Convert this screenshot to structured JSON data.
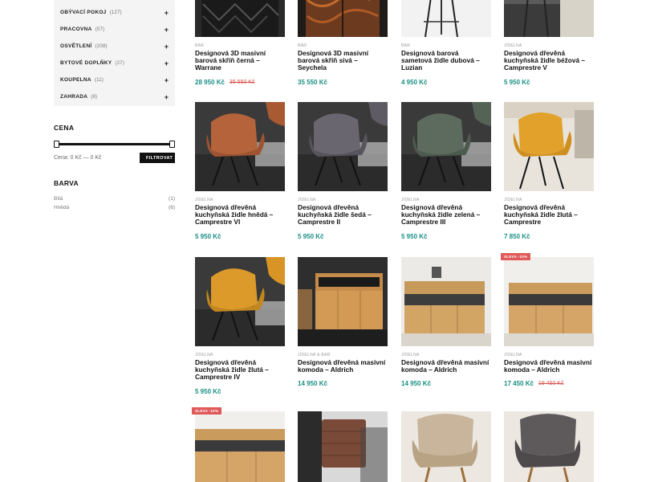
{
  "categories": [
    {
      "name": "OBÝVACÍ POKOJ",
      "count": "(127)",
      "expand": "+"
    },
    {
      "name": "PRACOVNA",
      "count": "(57)",
      "expand": "+"
    },
    {
      "name": "OSVĚTLENÍ",
      "count": "(208)",
      "expand": "+"
    },
    {
      "name": "BYTOVÉ DOPLŇKY",
      "count": "(27)",
      "expand": "+"
    },
    {
      "name": "KOUPELNA",
      "count": "(11)",
      "expand": "+"
    },
    {
      "name": "ZAHRADA",
      "count": "(8)",
      "expand": "+"
    }
  ],
  "price_filter": {
    "heading": "CENA",
    "label": "Cena: 0 Kč — 0 Kč",
    "button": "FILTROVAT"
  },
  "color_filter": {
    "heading": "BARVA",
    "items": [
      {
        "name": "Bílá",
        "count": "(1)"
      },
      {
        "name": "Hnědá",
        "count": "(6)"
      }
    ]
  },
  "products": [
    {
      "category": "BAR",
      "title": "Designová 3D masivní barová skříň černá – Warrane",
      "price": "28 950 Kč",
      "old_price": "35 550 Kč",
      "badge": "",
      "image": "cabinet-black"
    },
    {
      "category": "BAR",
      "title": "Designová 3D masivní barová skříň sivá – Seychela",
      "price": "35 550 Kč",
      "old_price": "",
      "badge": "",
      "image": "cabinet-wood"
    },
    {
      "category": "BAR",
      "title": "Designová barová sametová židle dubová – Luzian",
      "price": "4 950 Kč",
      "old_price": "",
      "badge": "",
      "image": "barstool"
    },
    {
      "category": "JÍDELNA",
      "title": "Designová dřevěná kuchyňská židle béžová – Camprestre V",
      "price": "5 950 Kč",
      "old_price": "",
      "badge": "",
      "image": "chair-beige-top"
    },
    {
      "category": "JÍDELNA",
      "title": "Designová dřevěná kuchyňská židle hnědá – Camprestre VI",
      "price": "5 950 Kč",
      "old_price": "",
      "badge": "",
      "image": "chair-brown"
    },
    {
      "category": "JÍDELNA",
      "title": "Designová dřevěná kuchyňská židle šedá – Camprestre II",
      "price": "5 950 Kč",
      "old_price": "",
      "badge": "",
      "image": "chair-grey"
    },
    {
      "category": "JÍDELNA",
      "title": "Designová dřevěná kuchyňská židle zelená – Camprestre III",
      "price": "5 950 Kč",
      "old_price": "",
      "badge": "",
      "image": "chair-green"
    },
    {
      "category": "JÍDELNA",
      "title": "Designová dřevěná kuchyňská židle žlutá – Camprestre",
      "price": "7 850 Kč",
      "old_price": "",
      "badge": "",
      "image": "chair-yellow-light"
    },
    {
      "category": "JÍDELNA",
      "title": "Designová dřevěná kuchyňská židle žlutá – Camprestre IV",
      "price": "5 950 Kč",
      "old_price": "",
      "badge": "",
      "image": "chair-yellow-dark"
    },
    {
      "category": "JÍDELNA & BAR",
      "title": "Designová dřevěná masivní komoda – Aldrich",
      "price": "14 950 Kč",
      "old_price": "",
      "badge": "",
      "image": "sideboard-dark-room"
    },
    {
      "category": "JÍDELNA",
      "title": "Designová dřevěná masivní komoda – Aldrich",
      "price": "14 950 Kč",
      "old_price": "",
      "badge": "",
      "image": "sideboard-white-room"
    },
    {
      "category": "JÍDELNA",
      "title": "Designová dřevěná masivní komoda – Aldrich",
      "price": "17 450 Kč",
      "old_price": "19 450 Kč",
      "badge": "SLEVA -10%",
      "image": "sideboard-brick-room"
    },
    {
      "category": "",
      "title": "",
      "price": "",
      "old_price": "",
      "badge": "SLEVA -10%",
      "image": "sideboard-partial"
    },
    {
      "category": "",
      "title": "",
      "price": "",
      "old_price": "",
      "badge": "",
      "image": "chair-leather"
    },
    {
      "category": "",
      "title": "",
      "price": "",
      "old_price": "",
      "badge": "",
      "image": "chair-beige-wood"
    },
    {
      "category": "",
      "title": "",
      "price": "",
      "old_price": "",
      "badge": "",
      "image": "chair-grey-wood"
    }
  ]
}
